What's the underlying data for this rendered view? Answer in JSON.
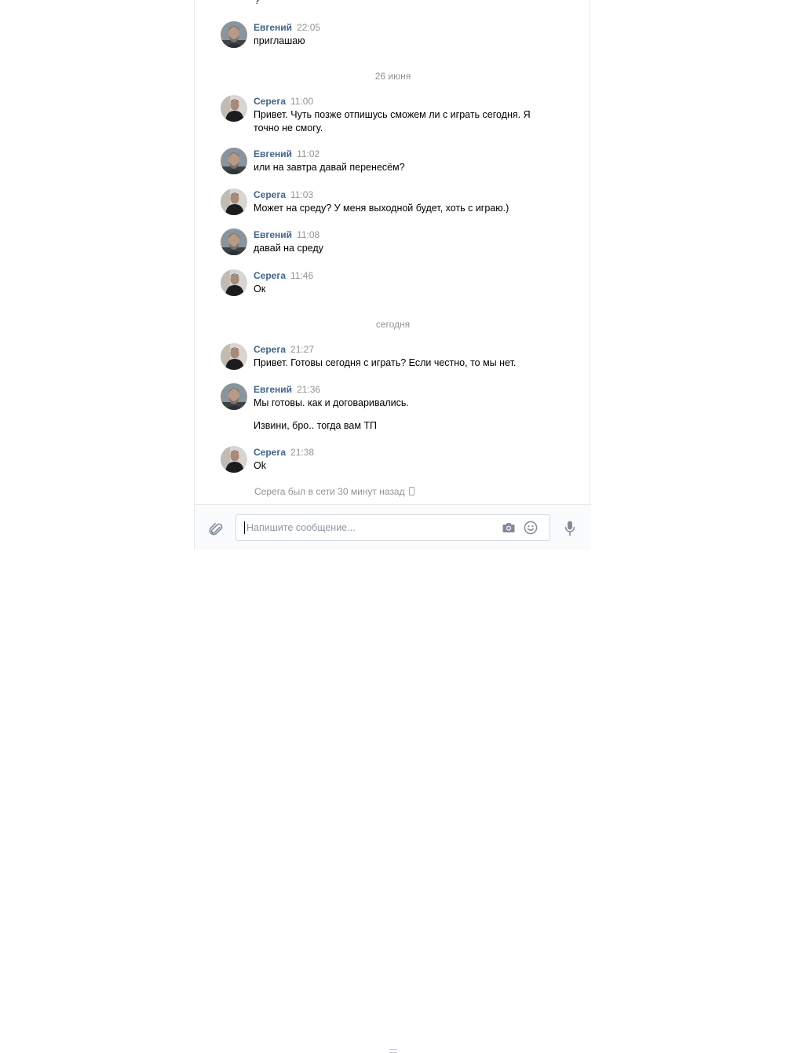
{
  "history": {
    "cut_off_text": "?",
    "date_separators": [
      "26 июня",
      "сегодня"
    ],
    "messages": [
      {
        "author": "Евгений",
        "time": "22:05",
        "text": "приглашаю",
        "extra": ""
      },
      {
        "author": "Серега",
        "time": "11:00",
        "text": "Привет. Чуть позже отпишусь сможем ли с играть сегодня. Я точно не смогу.",
        "extra": ""
      },
      {
        "author": "Евгений",
        "time": "11:02",
        "text": "или на завтра давай перенесём?",
        "extra": ""
      },
      {
        "author": "Серега",
        "time": "11:03",
        "text": "Может на среду? У меня выходной будет, хоть с играю.)",
        "extra": ""
      },
      {
        "author": "Евгений",
        "time": "11:08",
        "text": "давай на среду",
        "extra": ""
      },
      {
        "author": "Серега",
        "time": "11:46",
        "text": "Ок",
        "extra": ""
      },
      {
        "author": "Серега",
        "time": "21:27",
        "text": "Привет. Готовы сегодня с играть? Если честно, то мы нет.",
        "extra": ""
      },
      {
        "author": "Евгений",
        "time": "21:36",
        "text": "Мы готовы. как и договаривались.",
        "extra": "Извини, бро.. тогда вам ТП"
      },
      {
        "author": "Серега",
        "time": "21:38",
        "text": "Ok",
        "extra": ""
      }
    ],
    "status": "Серега был в сети 30 минут назад"
  },
  "composer": {
    "value": "",
    "placeholder": "Напишите сообщение..."
  },
  "icons": {
    "attach": "paperclip-icon",
    "camera": "camera-icon",
    "smile": "smile-icon",
    "mic": "microphone-icon",
    "online_device": "mobile-phone-icon"
  },
  "colors": {
    "author": "#42648b",
    "meta": "#939393",
    "icon": "#828a99",
    "border": "#e7e8ec"
  }
}
